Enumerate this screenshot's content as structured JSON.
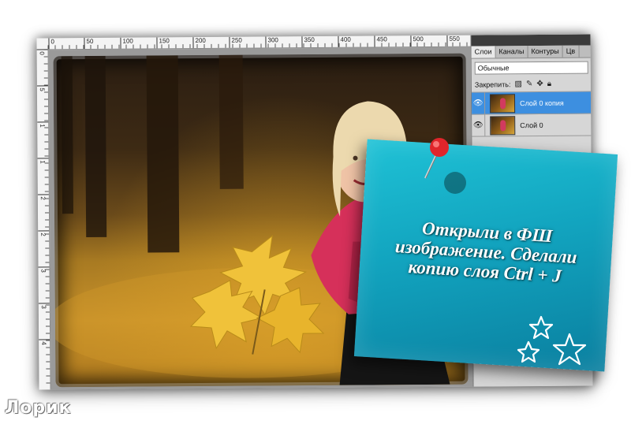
{
  "ruler": {
    "top_labels": [
      "0",
      "50",
      "100",
      "150",
      "200",
      "250",
      "300",
      "350",
      "400",
      "450",
      "500",
      "550"
    ],
    "left_labels": [
      "0",
      "5",
      "1",
      "1",
      "2",
      "2",
      "3",
      "3",
      "4"
    ]
  },
  "layers_panel": {
    "tabs": [
      {
        "label": "Слои",
        "active": true
      },
      {
        "label": "Каналы",
        "active": false
      },
      {
        "label": "Контуры",
        "active": false
      },
      {
        "label": "Цв",
        "active": false
      }
    ],
    "blend_mode": "Обычные",
    "lock_label": "Закрепить:",
    "lock_icons": [
      "lock-transparency-icon",
      "brush-icon",
      "move-icon",
      "lock-icon"
    ],
    "layers": [
      {
        "name": "Слой 0 копия",
        "selected": true,
        "visible": true
      },
      {
        "name": "Слой 0",
        "selected": false,
        "visible": true
      }
    ]
  },
  "note": {
    "text": "Открыли в ФШ изображение. Сделали копию слоя Ctrl + J",
    "color": "#12a4bf"
  },
  "watermark": "Лорик",
  "colors": {
    "selection": "#3d8fe0",
    "pin": "#e0252b"
  }
}
